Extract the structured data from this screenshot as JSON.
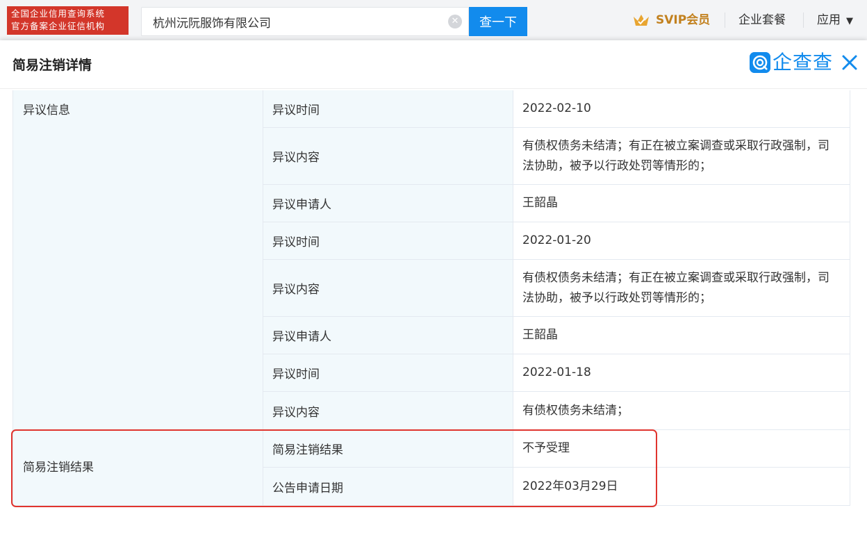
{
  "topbar": {
    "badge_line1": "全国企业信用查询系统",
    "badge_line2": "官方备案企业征信机构",
    "search_value": "杭州沅阮服饰有限公司",
    "search_button": "查一下",
    "svip_label": "SVIP会员",
    "nav_packages": "企业套餐",
    "nav_apps": "应用",
    "icons": {
      "clear": "clear-icon",
      "crown": "crown-icon",
      "caret": "caret-down-icon"
    }
  },
  "modal": {
    "title": "简易注销详情",
    "logo_text": "企查查",
    "icons": {
      "logo": "qichacha-logo-icon",
      "close": "close-icon"
    }
  },
  "objection": {
    "label": "异议信息",
    "rows": [
      {
        "label": "异议时间",
        "value": "2022-02-10"
      },
      {
        "label": "异议内容",
        "value": "有债权债务未结清；有正在被立案调查或采取行政强制，司法协助，被予以行政处罚等情形的；"
      },
      {
        "label": "异议申请人",
        "value": "王韶晶"
      },
      {
        "label": "异议时间",
        "value": "2022-01-20"
      },
      {
        "label": "异议内容",
        "value": "有债权债务未结清；有正在被立案调查或采取行政强制，司法协助，被予以行政处罚等情形的；"
      },
      {
        "label": "异议申请人",
        "value": "王韶晶"
      },
      {
        "label": "异议时间",
        "value": "2022-01-18"
      },
      {
        "label": "异议内容",
        "value": "有债权债务未结清；"
      }
    ]
  },
  "result": {
    "label": "简易注销结果",
    "rows": [
      {
        "label": "简易注销结果",
        "value": "不予受理"
      },
      {
        "label": "公告申请日期",
        "value": "2022年03月29日"
      }
    ]
  },
  "colors": {
    "brand_blue": "#128bed",
    "badge_red": "#d3362a",
    "svip_gold": "#c2811f",
    "highlight_red": "#e0342e",
    "label_bg": "#f2f9fc"
  }
}
